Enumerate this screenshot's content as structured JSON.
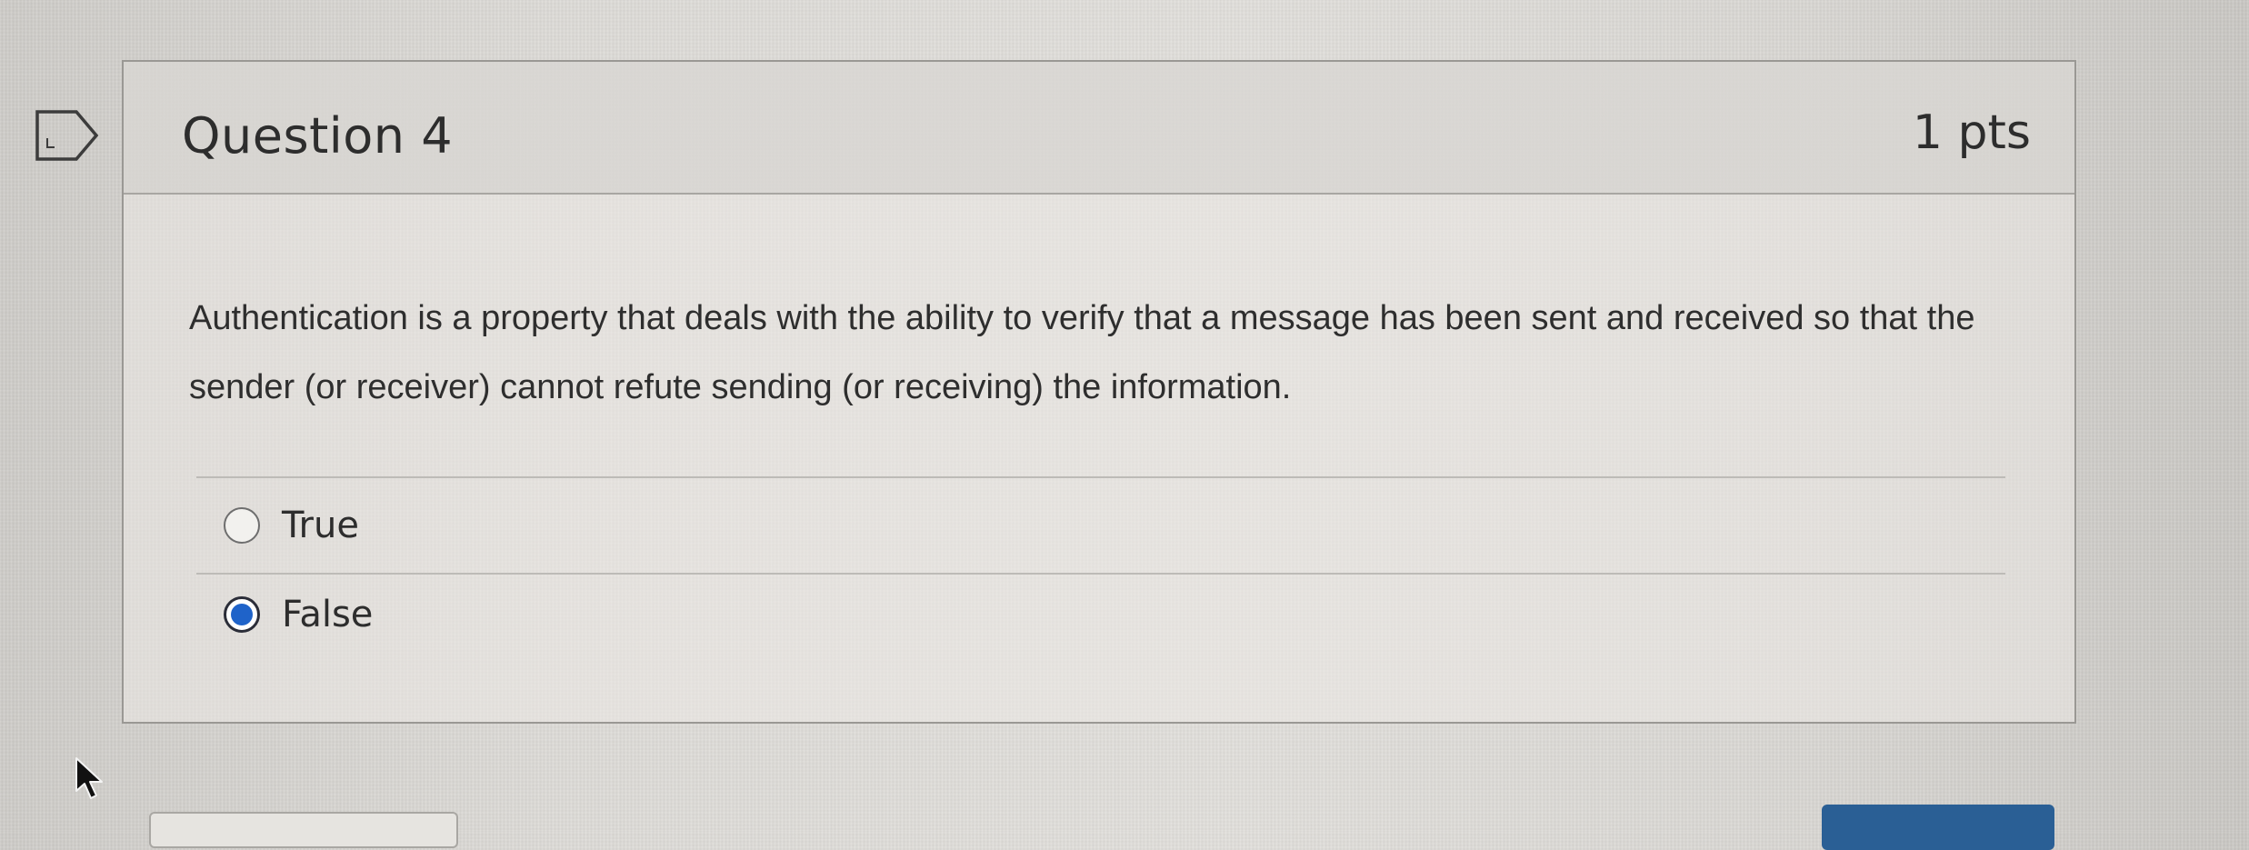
{
  "icons": {
    "flag": "flag-icon",
    "cursor": "mouse-pointer-icon"
  },
  "question": {
    "title": "Question 4",
    "points": "1 pts",
    "text": "Authentication is a property that deals with the ability to verify that a message has been sent and received so that the sender (or receiver) cannot refute sending (or receiving) the information.",
    "answers": [
      {
        "label": "True",
        "selected": false
      },
      {
        "label": "False",
        "selected": true
      }
    ],
    "selected_answer": "False"
  },
  "colors": {
    "radio_selected": "#1f63c9",
    "card_border": "#9a9894",
    "header_bg": "#d0cec9",
    "submit_button": "#2a5f95"
  }
}
